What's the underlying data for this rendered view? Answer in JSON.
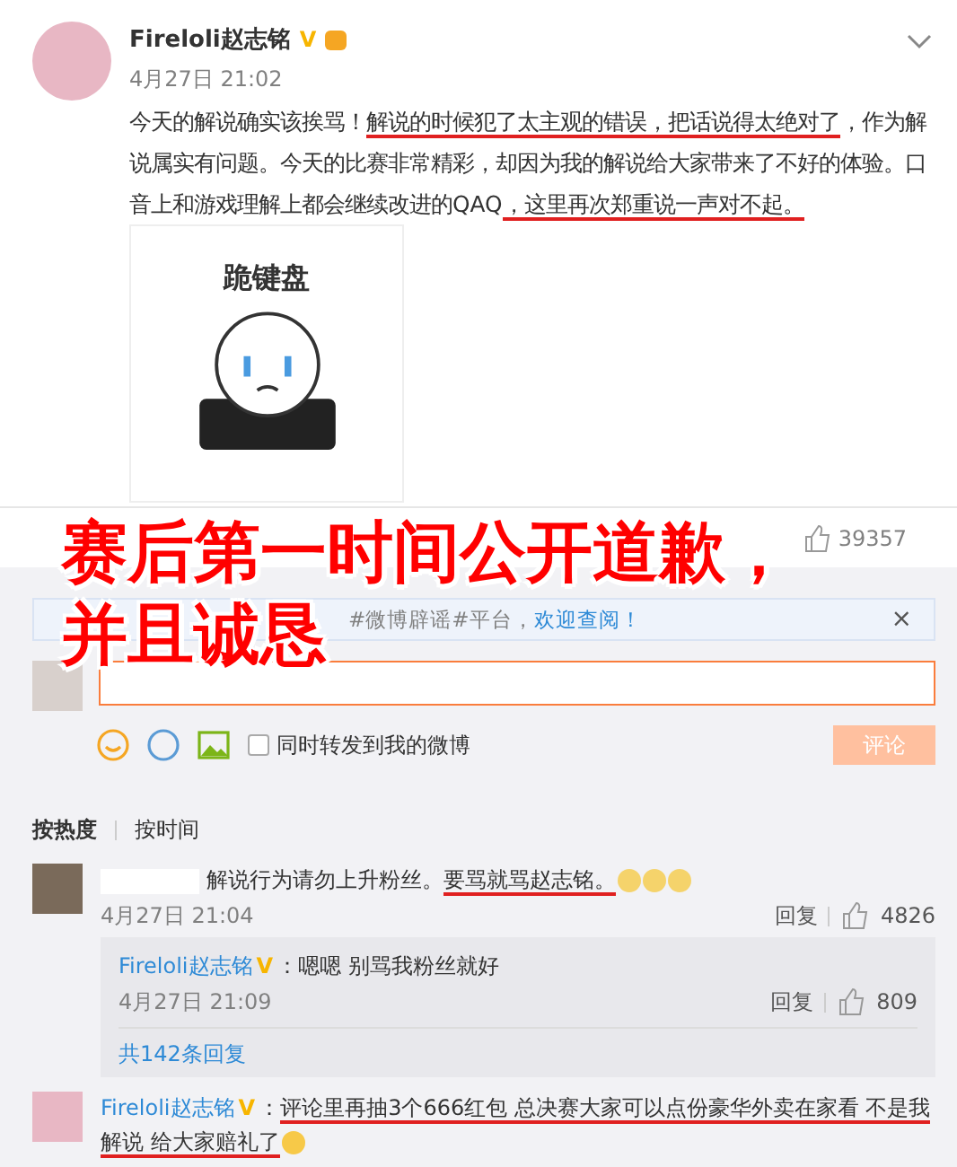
{
  "post": {
    "author": "Fireloli赵志铭",
    "badge": "V",
    "time": "4月27日 21:02",
    "body": [
      {
        "text": "今天的解说确实该挨骂！",
        "underlined": false
      },
      {
        "text": "解说的时候犯了太主观的错误，把话说得太绝对了",
        "underlined": true
      },
      {
        "text": "，作为解说属实有问题。今天的比赛非常精彩，却因为我的解说给大家带来了不好的体验。口音上和游戏理解上都会继续改进的QAQ",
        "underlined": false
      },
      {
        "text": "，这里再次郑重说一声对不起。",
        "underlined": true
      }
    ],
    "sticker_caption": "跪键盘",
    "likes": "39357"
  },
  "overlay": {
    "lines": [
      "赛后第一时间公开道歉，",
      "并且诚恳"
    ]
  },
  "notice": {
    "text": "#微博辟谣#平台，",
    "link": "欢迎查阅！",
    "close": "×"
  },
  "composer": {
    "repost_label": "同时转发到我的微博",
    "repost_checked": false,
    "submit": "评论"
  },
  "sort_tabs": [
    {
      "label": "按热度",
      "selected": true
    },
    {
      "label": "按时间",
      "selected": false
    }
  ],
  "comments": [
    {
      "body": [
        {
          "text": "解说行为请勿上升粉丝。",
          "underlined": false
        },
        {
          "text": "要骂就骂赵志铭。",
          "underlined": true
        }
      ],
      "emojis": [
        {
          "kind": "doge"
        },
        {
          "kind": "doge"
        },
        {
          "kind": "doge"
        }
      ],
      "time": "4月27日 21:04",
      "reply": "回复",
      "likes": "4826",
      "replies": [
        {
          "author": "Fireloli赵志铭",
          "badge": "V",
          "text": "：嗯嗯 别骂我粉丝就好",
          "time": "4月27日 21:09",
          "reply": "回复",
          "likes": "809"
        }
      ],
      "more_replies": "共142条回复"
    },
    {
      "author": "Fireloli赵志铭",
      "badge": "V",
      "body": [
        {
          "text": "：",
          "underlined": false
        },
        {
          "text": "评论里再抽3个666红包 总决赛大家可以点份豪华外卖在家看 不是我解说 给大家赔礼了",
          "underlined": true
        }
      ],
      "emojis": [
        {
          "kind": "pleading"
        }
      ]
    }
  ]
}
